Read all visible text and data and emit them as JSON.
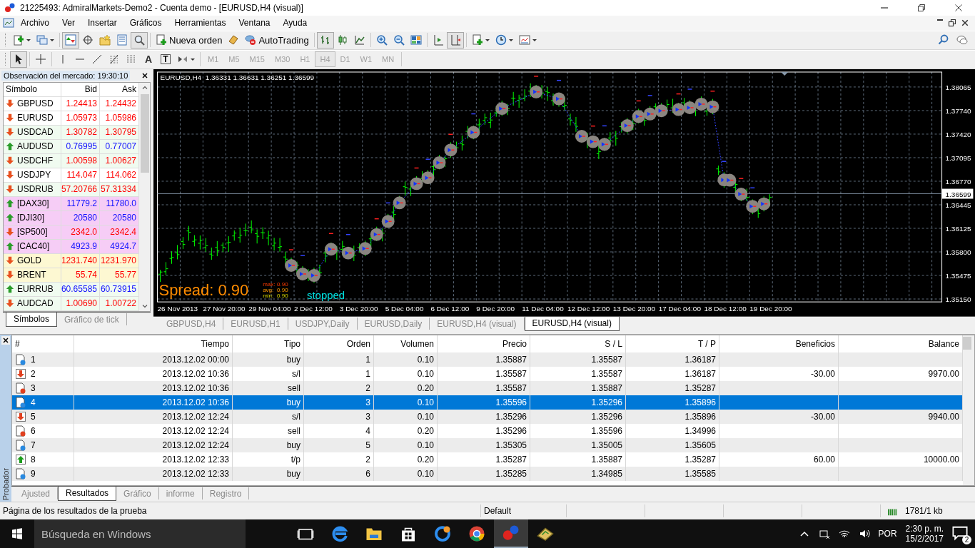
{
  "window": {
    "title": "21225493: AdmiralMarkets-Demo2 - Cuenta demo - [EURUSD,H4 (visual)]"
  },
  "menu": [
    "Archivo",
    "Ver",
    "Insertar",
    "Gráficos",
    "Herramientas",
    "Ventana",
    "Ayuda"
  ],
  "toolbar": [
    {
      "kind": "new-chart",
      "pressed": false,
      "dropdown": true
    },
    {
      "kind": "profiles",
      "pressed": false,
      "dropdown": true
    },
    {
      "kind": "market-watch",
      "pressed": true,
      "dropdown": false
    },
    {
      "kind": "navigator",
      "pressed": false,
      "dropdown": false
    },
    {
      "kind": "favorites",
      "pressed": false,
      "dropdown": false
    },
    {
      "kind": "terminal",
      "pressed": false,
      "dropdown": false
    },
    {
      "kind": "tester",
      "pressed": true,
      "dropdown": false
    },
    {
      "kind": "new-order",
      "label": "Nueva orden",
      "pressed": false,
      "dropdown": false
    },
    {
      "kind": "metaeditor",
      "pressed": false,
      "dropdown": false
    },
    {
      "kind": "autotrading",
      "label": "AutoTrading",
      "pressed": false,
      "dropdown": false
    },
    {
      "kind": "bar-chart",
      "pressed": true,
      "dropdown": false
    },
    {
      "kind": "candles",
      "pressed": false,
      "dropdown": false
    },
    {
      "kind": "line-chart",
      "pressed": false,
      "dropdown": false
    },
    {
      "kind": "zoom-in",
      "pressed": false,
      "dropdown": false
    },
    {
      "kind": "zoom-out",
      "pressed": false,
      "dropdown": false
    },
    {
      "kind": "tile",
      "pressed": false,
      "dropdown": false
    },
    {
      "kind": "autoscroll",
      "pressed": false,
      "dropdown": false
    },
    {
      "kind": "chart-shift",
      "pressed": true,
      "dropdown": false
    },
    {
      "kind": "indicators",
      "pressed": false,
      "dropdown": true
    },
    {
      "kind": "periods",
      "pressed": false,
      "dropdown": true
    },
    {
      "kind": "templates",
      "pressed": false,
      "dropdown": true
    }
  ],
  "drawing_toolbar": [
    {
      "kind": "cursor",
      "pressed": true,
      "dropdown": false
    },
    {
      "kind": "crosshair",
      "pressed": false,
      "dropdown": false
    },
    {
      "kind": "vertical-line",
      "pressed": false,
      "dropdown": false
    },
    {
      "kind": "horizontal-line",
      "pressed": false,
      "dropdown": false
    },
    {
      "kind": "trend-line",
      "pressed": false,
      "dropdown": false
    },
    {
      "kind": "fibonacci",
      "pressed": false,
      "dropdown": false
    },
    {
      "kind": "grid-lines",
      "pressed": false,
      "dropdown": false
    },
    {
      "kind": "text",
      "label": "A",
      "pressed": false,
      "dropdown": false
    },
    {
      "kind": "text-label",
      "label": "T",
      "pressed": false,
      "dropdown": false
    },
    {
      "kind": "arrows",
      "pressed": false,
      "dropdown": true
    }
  ],
  "periods": [
    {
      "label": "M1",
      "selected": false
    },
    {
      "label": "M5",
      "selected": false
    },
    {
      "label": "M15",
      "selected": false
    },
    {
      "label": "M30",
      "selected": false
    },
    {
      "label": "H1",
      "selected": false
    },
    {
      "label": "H4",
      "selected": true
    },
    {
      "label": "D1",
      "selected": false
    },
    {
      "label": "W1",
      "selected": false
    },
    {
      "label": "MN",
      "selected": false
    }
  ],
  "market_watch": {
    "title": "Observación del mercado: 19:30:10",
    "columns": [
      "Símbolo",
      "Bid",
      "Ask"
    ],
    "rows": [
      {
        "symbol": "GBPUSD",
        "bid": "1.24413",
        "ask": "1.24432",
        "rising": false,
        "color": "#ffffff"
      },
      {
        "symbol": "EURUSD",
        "bid": "1.05973",
        "ask": "1.05986",
        "rising": false,
        "color": "#ffffff"
      },
      {
        "symbol": "USDCAD",
        "bid": "1.30782",
        "ask": "1.30795",
        "rising": false,
        "color": "#f0fbf0"
      },
      {
        "symbol": "AUDUSD",
        "bid": "0.76995",
        "ask": "0.77007",
        "rising": true,
        "color": "#f0fbf0"
      },
      {
        "symbol": "USDCHF",
        "bid": "1.00598",
        "ask": "1.00627",
        "rising": false,
        "color": "#f0fbf0"
      },
      {
        "symbol": "USDJPY",
        "bid": "114.047",
        "ask": "114.062",
        "rising": false,
        "color": "#ffffff"
      },
      {
        "symbol": "USDRUB",
        "bid": "57.20766",
        "ask": "57.31334",
        "rising": false,
        "color": "#f0fbf0"
      },
      {
        "symbol": "[DAX30]",
        "bid": "11779.2",
        "ask": "11780.0",
        "rising": true,
        "color": "#f6cdf6"
      },
      {
        "symbol": "[DJI30]",
        "bid": "20580",
        "ask": "20580",
        "rising": true,
        "color": "#f6cdf6"
      },
      {
        "symbol": "[SP500]",
        "bid": "2342.0",
        "ask": "2342.4",
        "rising": false,
        "color": "#f6cdf6"
      },
      {
        "symbol": "[CAC40]",
        "bid": "4923.9",
        "ask": "4924.7",
        "rising": true,
        "color": "#f6cdf6"
      },
      {
        "symbol": "GOLD",
        "bid": "1231.740",
        "ask": "1231.970",
        "rising": false,
        "color": "#fdf8d2"
      },
      {
        "symbol": "BRENT",
        "bid": "55.74",
        "ask": "55.77",
        "rising": false,
        "color": "#fdf8d2"
      },
      {
        "symbol": "EURRUB",
        "bid": "60.65585",
        "ask": "60.73915",
        "rising": true,
        "color": "#f0fbf0"
      },
      {
        "symbol": "AUDCAD",
        "bid": "1.00690",
        "ask": "1.00722",
        "rising": false,
        "color": "#f0fbf0"
      }
    ],
    "tabs": [
      {
        "label": "Símbolos",
        "selected": true
      },
      {
        "label": "Gráfico de tick",
        "selected": false
      }
    ]
  },
  "chart": {
    "header": "EURUSD,H4  1.36331 1.36631 1.36251 1.36599",
    "price_labels": [
      "1.38065",
      "1.37740",
      "1.37420",
      "1.37095",
      "1.36770",
      "1.36445",
      "1.36125",
      "1.35800",
      "1.35475",
      "1.35150"
    ],
    "current_price": "1.36599",
    "time_labels": [
      "26 Nov 2013",
      "27 Nov 20:00",
      "29 Nov 04:00",
      "2 Dec 12:00",
      "3 Dec 20:00",
      "5 Dec 04:00",
      "6 Dec 12:00",
      "9 Dec 20:00",
      "11 Dec 04:00",
      "12 Dec 12:00",
      "13 Dec 20:00",
      "17 Dec 04:00",
      "18 Dec 12:00",
      "19 Dec 20:00"
    ],
    "spread": "Spread: 0.90",
    "spread_stats": [
      {
        "label": "max:",
        "value": "0.90"
      },
      {
        "label": "avg:",
        "value": "0.90"
      },
      {
        "label": "min:",
        "value": "0.90"
      }
    ],
    "status": "stopped"
  },
  "chart_tabs": [
    {
      "label": "GBPUSD,H4",
      "selected": false
    },
    {
      "label": "EURUSD,H1",
      "selected": false
    },
    {
      "label": "USDJPY,Daily",
      "selected": false
    },
    {
      "label": "EURUSD,Daily",
      "selected": false
    },
    {
      "label": "EURUSD,H4 (visual)",
      "selected": false
    },
    {
      "label": "EURUSD,H4 (visual)",
      "selected": true
    }
  ],
  "tester": {
    "title": "Probador",
    "columns": [
      "#",
      "Tiempo",
      "Tipo",
      "Orden",
      "Volumen",
      "Precio",
      "S / L",
      "T / P",
      "Beneficios",
      "Balance"
    ],
    "rows": [
      {
        "kind": "buy",
        "cells": [
          "1",
          "2013.12.02 00:00",
          "buy",
          "1",
          "0.10",
          "1.35887",
          "1.35587",
          "1.36187",
          "",
          ""
        ],
        "selected": false
      },
      {
        "kind": "stop-loss",
        "cells": [
          "2",
          "2013.12.02 10:36",
          "s/l",
          "1",
          "0.10",
          "1.35587",
          "1.35587",
          "1.36187",
          "-30.00",
          "9970.00"
        ],
        "selected": false
      },
      {
        "kind": "sell",
        "cells": [
          "3",
          "2013.12.02 10:36",
          "sell",
          "2",
          "0.20",
          "1.35587",
          "1.35887",
          "1.35287",
          "",
          ""
        ],
        "selected": false
      },
      {
        "kind": "buy",
        "cells": [
          "4",
          "2013.12.02 10:36",
          "buy",
          "3",
          "0.10",
          "1.35596",
          "1.35296",
          "1.35896",
          "",
          ""
        ],
        "selected": true
      },
      {
        "kind": "stop-loss",
        "cells": [
          "5",
          "2013.12.02 12:24",
          "s/l",
          "3",
          "0.10",
          "1.35296",
          "1.35296",
          "1.35896",
          "-30.00",
          "9940.00"
        ],
        "selected": false
      },
      {
        "kind": "sell",
        "cells": [
          "6",
          "2013.12.02 12:24",
          "sell",
          "4",
          "0.20",
          "1.35296",
          "1.35596",
          "1.34996",
          "",
          ""
        ],
        "selected": false
      },
      {
        "kind": "buy",
        "cells": [
          "7",
          "2013.12.02 12:24",
          "buy",
          "5",
          "0.10",
          "1.35305",
          "1.35005",
          "1.35605",
          "",
          ""
        ],
        "selected": false
      },
      {
        "kind": "take-profit",
        "cells": [
          "8",
          "2013.12.02 12:33",
          "t/p",
          "2",
          "0.20",
          "1.35287",
          "1.35887",
          "1.35287",
          "60.00",
          "10000.00"
        ],
        "selected": false
      },
      {
        "kind": "buy",
        "cells": [
          "9",
          "2013.12.02 12:33",
          "buy",
          "6",
          "0.10",
          "1.35285",
          "1.34985",
          "1.35585",
          "",
          ""
        ],
        "selected": false
      }
    ],
    "tabs": [
      {
        "label": "Ajusted",
        "selected": false
      },
      {
        "label": "Resultados",
        "selected": true
      },
      {
        "label": "Gráfico",
        "selected": false
      },
      {
        "label": "informe",
        "selected": false
      },
      {
        "label": "Registro",
        "selected": false
      }
    ]
  },
  "status_bar": {
    "message": "Página de los resultados de la prueba",
    "profile": "Default",
    "traffic": "1781/1 kb"
  },
  "taskbar": {
    "search_placeholder": "Búsqueda en Windows",
    "apps": [
      {
        "kind": "task-view",
        "active": false
      },
      {
        "kind": "edge",
        "active": false
      },
      {
        "kind": "explorer",
        "active": false
      },
      {
        "kind": "store",
        "active": false
      },
      {
        "kind": "ccleaner",
        "active": false
      },
      {
        "kind": "chrome",
        "active": false
      },
      {
        "kind": "metatrader",
        "active": true
      },
      {
        "kind": "book-app",
        "active": false
      }
    ],
    "language": "POR",
    "time": "2:30 p. m.",
    "date": "15/2/2017",
    "notifications": "2"
  }
}
